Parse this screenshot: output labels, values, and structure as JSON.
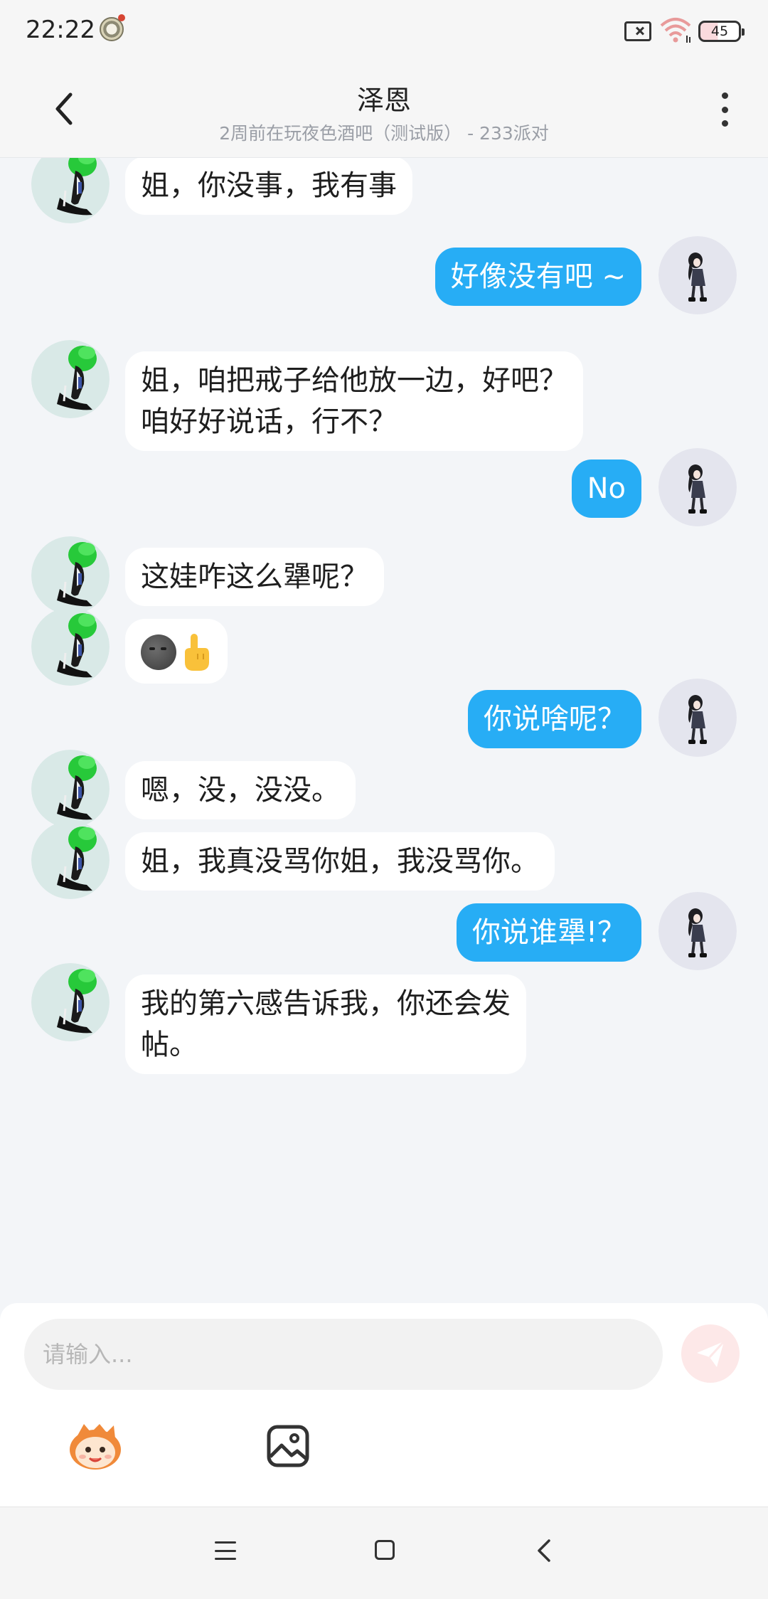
{
  "status_bar": {
    "time": "22:22",
    "battery": "45"
  },
  "header": {
    "title": "泽恩",
    "subtitle": "2周前在玩夜色酒吧（测试版） - 233派对"
  },
  "messages": [
    {
      "side": "in",
      "text": "姐，你没事，我有事"
    },
    {
      "side": "out",
      "text": "好像没有吧 ~"
    },
    {
      "side": "in",
      "text": "姐，咱把戒子给他放一边，好吧？\n咱好好说话，行不？"
    },
    {
      "side": "out",
      "text": "No"
    },
    {
      "side": "in",
      "text": "这娃咋这么犟呢？"
    },
    {
      "side": "in",
      "text": "",
      "emoji": [
        "new-moon-face",
        "pointing-up-hand"
      ]
    },
    {
      "side": "out",
      "text": "你说啥呢？"
    },
    {
      "side": "in",
      "text": "嗯，没，没没。"
    },
    {
      "side": "in",
      "text": "姐，我真没骂你姐，我没骂你。"
    },
    {
      "side": "out",
      "text": "你说谁犟!？"
    },
    {
      "side": "in",
      "text": "我的第六感告诉我，你还会发\n帖。"
    }
  ],
  "composer": {
    "placeholder": "请输入..."
  },
  "colors": {
    "outgoing_bubble": "#27adf5",
    "incoming_bubble": "#ffffff",
    "background": "#f3f5f8"
  }
}
